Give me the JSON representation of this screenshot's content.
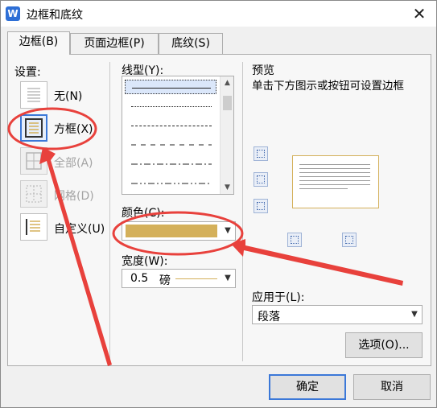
{
  "window": {
    "title": "边框和底纹",
    "app_icon_letter": "W",
    "close_glyph": "✕"
  },
  "tabs": [
    {
      "label": "边框(B)",
      "active": true
    },
    {
      "label": "页面边框(P)",
      "active": false
    },
    {
      "label": "底纹(S)",
      "active": false
    }
  ],
  "settings": {
    "heading": "设置:",
    "items": [
      {
        "label": "无(N)",
        "enabled": true,
        "selected": false
      },
      {
        "label": "方框(X)",
        "enabled": true,
        "selected": true
      },
      {
        "label": "全部(A)",
        "enabled": false,
        "selected": false
      },
      {
        "label": "网格(D)",
        "enabled": false,
        "selected": false
      },
      {
        "label": "自定义(U)",
        "enabled": true,
        "selected": false
      }
    ]
  },
  "line_style": {
    "label": "线型(Y):",
    "selected_index": 0
  },
  "color": {
    "label": "颜色(C):",
    "value": "#d4b05a"
  },
  "width": {
    "label": "宽度(W):",
    "value": "0.5",
    "unit": "磅"
  },
  "preview": {
    "heading": "预览",
    "hint": "单击下方图示或按钮可设置边框"
  },
  "apply_to": {
    "label": "应用于(L):",
    "value": "段落"
  },
  "buttons": {
    "options": "选项(O)...",
    "ok": "确定",
    "cancel": "取消"
  },
  "annotation_color": "#e8413c"
}
